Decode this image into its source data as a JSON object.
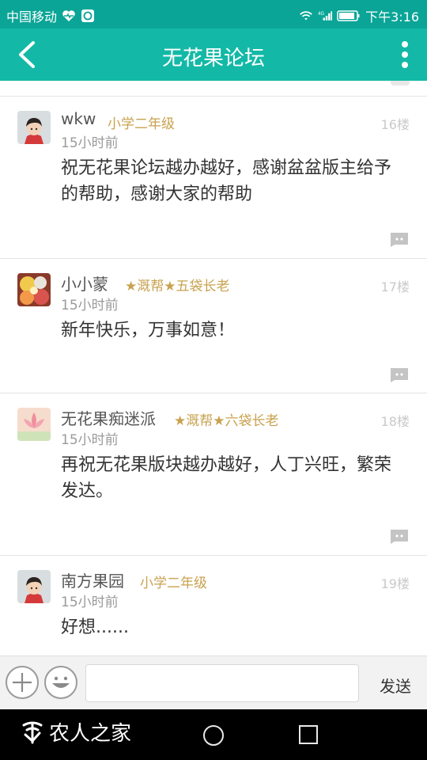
{
  "status_bar": {
    "carrier": "中国移动",
    "network": "4G",
    "time": "下午3:16"
  },
  "app_bar": {
    "title": "无花果论坛"
  },
  "posts": [
    {
      "author": "wkw",
      "rank": "小学二年级",
      "floor": "16楼",
      "time": "15小时前",
      "content": "祝无花果论坛越办越好，感谢盆盆版主给予的帮助，感谢大家的帮助"
    },
    {
      "author": "小小蒙",
      "rank": "★溉帮★五袋长老",
      "floor": "17楼",
      "time": "15小时前",
      "content": "新年快乐，万事如意！"
    },
    {
      "author": "无花果痴迷派",
      "rank": "★溉帮★六袋长老",
      "floor": "18楼",
      "time": "15小时前",
      "content": "再祝无花果版块越办越好，人丁兴旺，繁荣发达。"
    },
    {
      "author": "南方果园",
      "rank": "小学二年级",
      "floor": "19楼",
      "time": "15小时前",
      "content": "好想......"
    }
  ],
  "input_bar": {
    "placeholder": "",
    "send_label": "发送"
  },
  "watermark": {
    "text": "农人之家"
  },
  "colors": {
    "status_bar": "#0aa597",
    "app_bar": "#13b9a6",
    "rank": "#c8a24f"
  }
}
